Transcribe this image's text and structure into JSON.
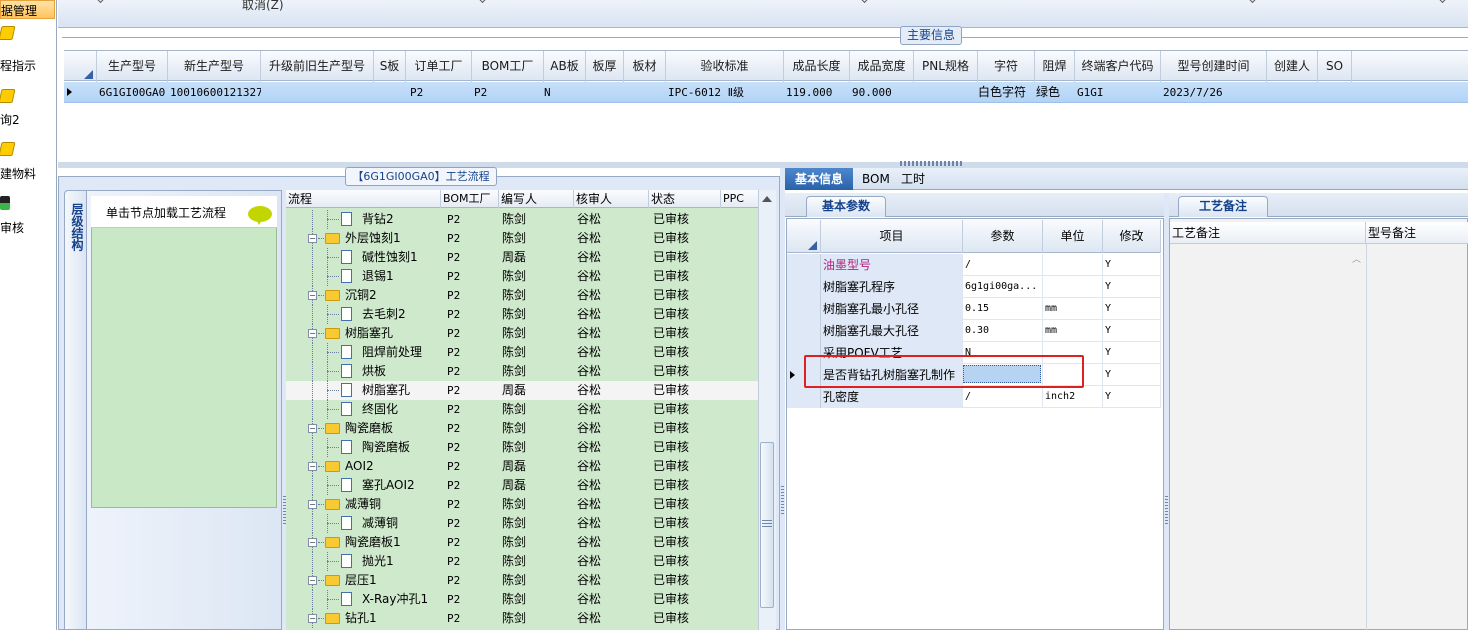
{
  "nav": {
    "items": [
      {
        "label": "据管理",
        "active": true
      },
      {
        "label": "程指示",
        "icon": "wand-icon"
      },
      {
        "label": "询2",
        "icon": "wand-icon"
      },
      {
        "label": "建物料",
        "icon": "wand-icon"
      },
      {
        "label": "审核",
        "icon": "traffic-icon"
      }
    ]
  },
  "toolbar": {
    "cancel_label": "取消(Z)"
  },
  "main_info": {
    "caption": "主要信息",
    "columns": [
      "生产型号",
      "新生产型号",
      "升级前旧生产型号",
      "S板",
      "订单工厂",
      "BOM工厂",
      "AB板",
      "板厚",
      "板材",
      "验收标准",
      "成品长度",
      "成品宽度",
      "PNL规格",
      "字符",
      "阻焊",
      "终端客户代码",
      "型号创建时间",
      "创建人",
      "SO"
    ],
    "row": [
      "6G1GI00GA0",
      "10010600121327",
      "",
      "",
      "P2",
      "P2",
      "N",
      "",
      "",
      "IPC-6012 Ⅱ级",
      "119.000",
      "90.000",
      "",
      "白色字符",
      "绿色",
      "G1GI",
      "2023/7/26",
      "",
      ""
    ]
  },
  "flow": {
    "caption": "【6G1GI00GA0】工艺流程",
    "vertical_tab": "层级结构",
    "tip_text": "单击节点加载工艺流程",
    "columns": [
      "流程",
      "BOM工厂",
      "编写人",
      "核审人",
      "状态",
      "PPC"
    ],
    "rows": [
      {
        "name": "背钻2",
        "level": 2,
        "bom": "P2",
        "writer": "陈剑",
        "reviewer": "谷松",
        "status": "已审核"
      },
      {
        "name": "外层蚀刻1",
        "level": 1,
        "bom": "P2",
        "writer": "陈剑",
        "reviewer": "谷松",
        "status": "已审核"
      },
      {
        "name": "碱性蚀刻1",
        "level": 2,
        "bom": "P2",
        "writer": "周磊",
        "reviewer": "谷松",
        "status": "已审核"
      },
      {
        "name": "退锡1",
        "level": 2,
        "bom": "P2",
        "writer": "陈剑",
        "reviewer": "谷松",
        "status": "已审核"
      },
      {
        "name": "沉铜2",
        "level": 1,
        "bom": "P2",
        "writer": "陈剑",
        "reviewer": "谷松",
        "status": "已审核"
      },
      {
        "name": "去毛刺2",
        "level": 2,
        "bom": "P2",
        "writer": "陈剑",
        "reviewer": "谷松",
        "status": "已审核"
      },
      {
        "name": "树脂塞孔",
        "level": 1,
        "bom": "P2",
        "writer": "陈剑",
        "reviewer": "谷松",
        "status": "已审核"
      },
      {
        "name": "阻焊前处理",
        "level": 2,
        "bom": "P2",
        "writer": "陈剑",
        "reviewer": "谷松",
        "status": "已审核"
      },
      {
        "name": "烘板",
        "level": 2,
        "bom": "P2",
        "writer": "陈剑",
        "reviewer": "谷松",
        "status": "已审核"
      },
      {
        "name": "树脂塞孔",
        "level": 2,
        "bom": "P2",
        "writer": "周磊",
        "reviewer": "谷松",
        "status": "已审核",
        "selected": true
      },
      {
        "name": "终固化",
        "level": 2,
        "bom": "P2",
        "writer": "陈剑",
        "reviewer": "谷松",
        "status": "已审核"
      },
      {
        "name": "陶瓷磨板",
        "level": 1,
        "bom": "P2",
        "writer": "陈剑",
        "reviewer": "谷松",
        "status": "已审核"
      },
      {
        "name": "陶瓷磨板",
        "level": 2,
        "bom": "P2",
        "writer": "陈剑",
        "reviewer": "谷松",
        "status": "已审核"
      },
      {
        "name": "AOI2",
        "level": 1,
        "bom": "P2",
        "writer": "周磊",
        "reviewer": "谷松",
        "status": "已审核"
      },
      {
        "name": "塞孔AOI2",
        "level": 2,
        "bom": "P2",
        "writer": "周磊",
        "reviewer": "谷松",
        "status": "已审核"
      },
      {
        "name": "减薄铜",
        "level": 1,
        "bom": "P2",
        "writer": "陈剑",
        "reviewer": "谷松",
        "status": "已审核"
      },
      {
        "name": "减薄铜",
        "level": 2,
        "bom": "P2",
        "writer": "陈剑",
        "reviewer": "谷松",
        "status": "已审核"
      },
      {
        "name": "陶瓷磨板1",
        "level": 1,
        "bom": "P2",
        "writer": "陈剑",
        "reviewer": "谷松",
        "status": "已审核"
      },
      {
        "name": "抛光1",
        "level": 2,
        "bom": "P2",
        "writer": "陈剑",
        "reviewer": "谷松",
        "status": "已审核"
      },
      {
        "name": "层压1",
        "level": 1,
        "bom": "P2",
        "writer": "陈剑",
        "reviewer": "谷松",
        "status": "已审核"
      },
      {
        "name": "X-Ray冲孔1",
        "level": 2,
        "bom": "P2",
        "writer": "陈剑",
        "reviewer": "谷松",
        "status": "已审核"
      },
      {
        "name": "钻孔1",
        "level": 1,
        "bom": "P2",
        "writer": "陈剑",
        "reviewer": "谷松",
        "status": "已审核"
      }
    ]
  },
  "right": {
    "tabs": [
      "基本信息",
      "BOM",
      "工时"
    ],
    "basic_params": {
      "tab_label": "基本参数",
      "columns": [
        "项目",
        "参数",
        "单位",
        "修改"
      ],
      "rows": [
        {
          "item": "油墨型号",
          "param": "/",
          "unit": "",
          "modify": "Y",
          "item_color": "#b0207a"
        },
        {
          "item": "树脂塞孔程序",
          "param": "6g1gi00ga...",
          "unit": "",
          "modify": "Y"
        },
        {
          "item": "树脂塞孔最小孔径",
          "param": "0.15",
          "unit": "mm",
          "modify": "Y"
        },
        {
          "item": "树脂塞孔最大孔径",
          "param": "0.30",
          "unit": "mm",
          "modify": "Y"
        },
        {
          "item": "采用POFV工艺",
          "param": "N",
          "unit": "",
          "modify": "Y"
        },
        {
          "item": "是否背钻孔树脂塞孔制作",
          "param": "/",
          "unit": "",
          "modify": "Y",
          "selected": true
        },
        {
          "item": "孔密度",
          "param": "/",
          "unit": "inch2",
          "modify": "Y"
        }
      ]
    },
    "notes": {
      "tab_label": "工艺备注",
      "columns": [
        "工艺备注",
        "型号备注"
      ]
    }
  },
  "colors": {
    "accent": "#2a62aa",
    "highlight_border": "#e02020",
    "tree_bg": "#cfe9cc"
  }
}
